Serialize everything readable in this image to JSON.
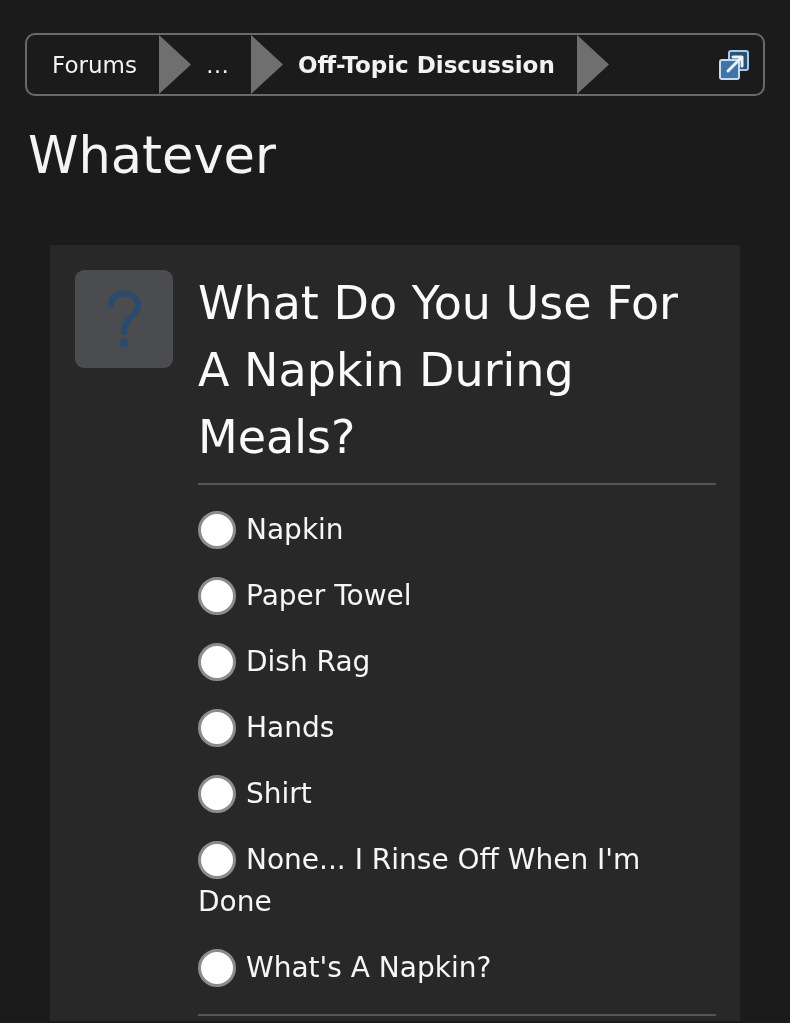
{
  "breadcrumb": {
    "items": [
      {
        "label": "Forums",
        "current": false
      },
      {
        "label": "…",
        "current": false
      },
      {
        "label": "Off-Topic Discussion",
        "current": true
      }
    ]
  },
  "page_title": "Whatever",
  "poll": {
    "question": "What Do You Use For A Napkin During Meals?",
    "options": [
      {
        "label": "Napkin",
        "selected": false
      },
      {
        "label": "Paper Towel",
        "selected": false
      },
      {
        "label": "Dish Rag",
        "selected": false
      },
      {
        "label": "Hands",
        "selected": false
      },
      {
        "label": "Shirt",
        "selected": false
      },
      {
        "label": "None... I Rinse Off When I'm Done",
        "selected": false
      },
      {
        "label": "What's A Napkin?",
        "selected": false
      }
    ]
  }
}
